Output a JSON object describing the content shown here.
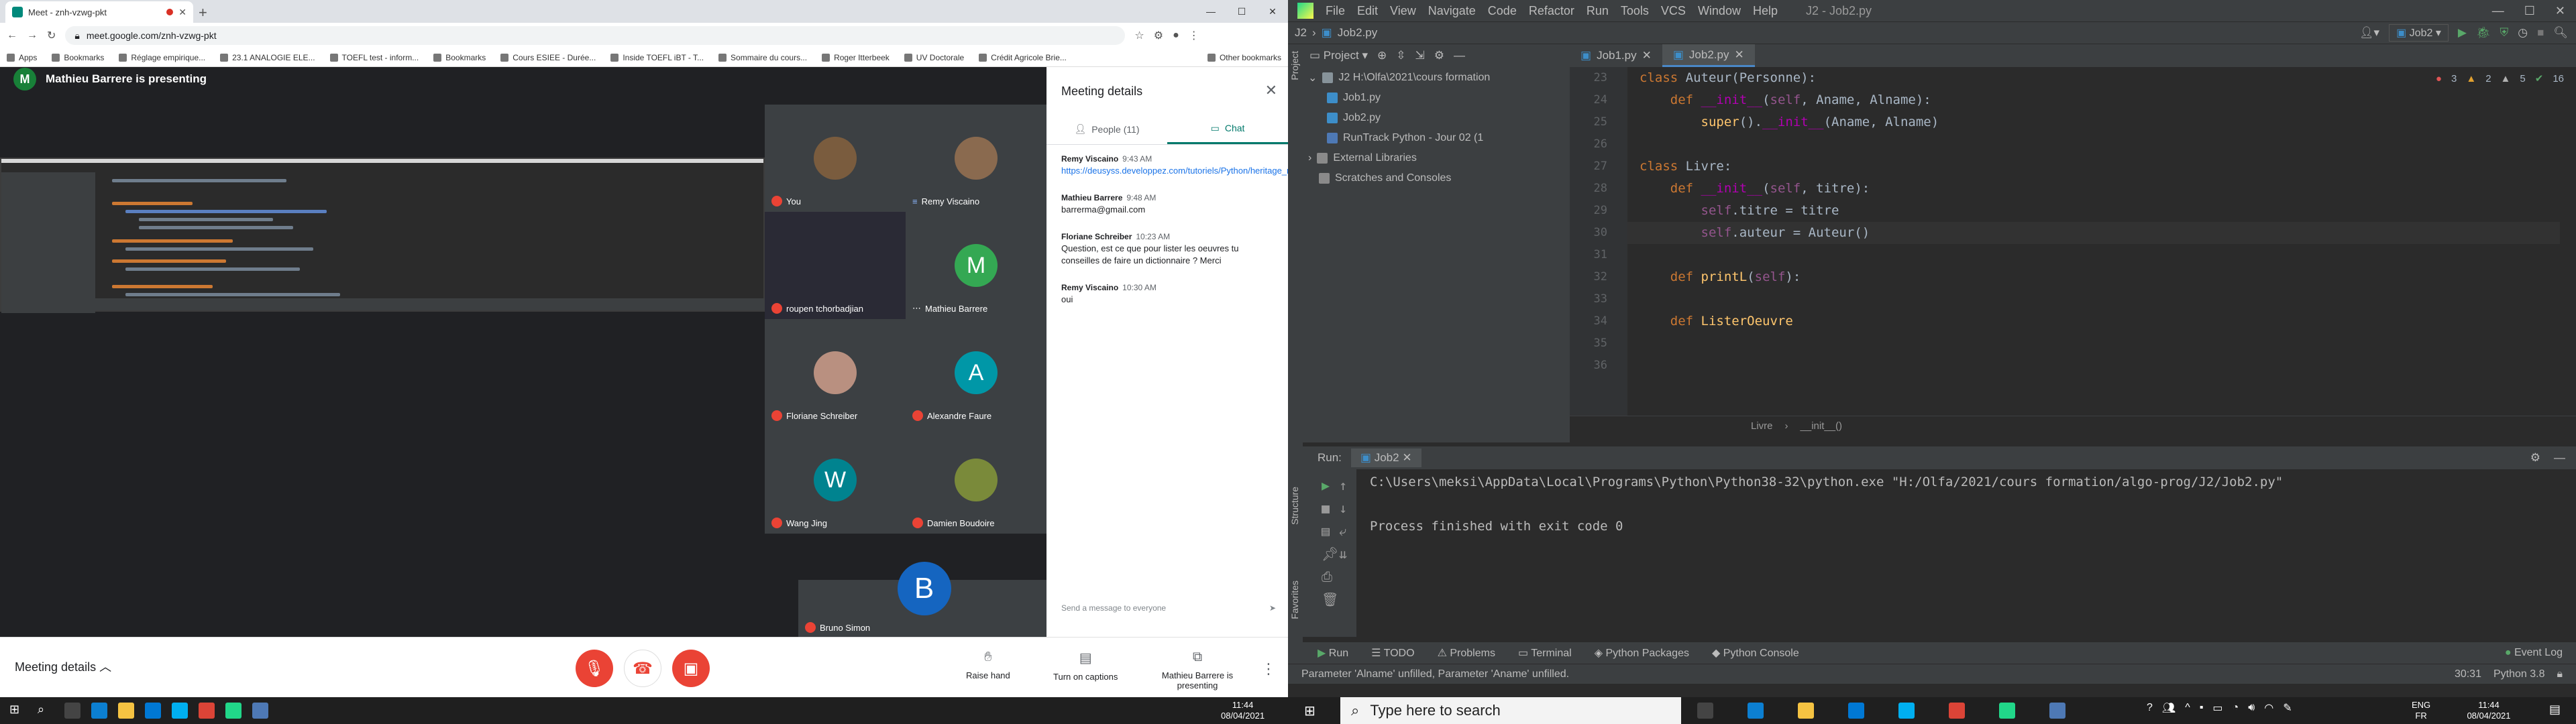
{
  "chrome": {
    "tab_title": "Meet - znh-vzwg-pkt",
    "new_tab": "+",
    "url": "meet.google.com/znh-vzwg-pkt",
    "bookmarks": [
      "Apps",
      "Bookmarks",
      "Réglage empirique...",
      "23.1 ANALOGIE ELE...",
      "TOEFL test - inform...",
      "Bookmarks",
      "Cours ESIEE - Durée...",
      "Inside TOEFL iBT - T...",
      "Sommaire du cours...",
      "Roger Itterbeek",
      "UV Doctorale",
      "Crédit Agricole Brie..."
    ],
    "other_bookmarks": "Other bookmarks"
  },
  "meet": {
    "presenter_initial": "M",
    "presenter_text": "Mathieu Barrere is presenting",
    "participants": [
      {
        "name": "You",
        "initial": "",
        "color": "#7a5c3e",
        "muted": true
      },
      {
        "name": "Remy Viscaino",
        "initial": "",
        "color": "#8a6a4f",
        "muted": false
      },
      {
        "name": "roupen tchorbadjian",
        "initial": "",
        "color": "#2a2a35",
        "muted": true
      },
      {
        "name": "Mathieu Barrere",
        "initial": "M",
        "color": "#34a853",
        "muted": false
      },
      {
        "name": "Floriane Schreiber",
        "initial": "",
        "color": "#b99080",
        "muted": true
      },
      {
        "name": "Alexandre Faure",
        "initial": "A",
        "color": "#0097a7",
        "muted": true
      },
      {
        "name": "Wang Jing",
        "initial": "W",
        "color": "#00838f",
        "muted": true
      },
      {
        "name": "Damien Boudoire",
        "initial": "",
        "color": "#7a8a3a",
        "muted": true
      }
    ],
    "big_tile": {
      "name": "Bruno Simon",
      "initial": "B",
      "color": "#1565c0"
    },
    "panel": {
      "title": "Meeting details",
      "tab_people": "People (11)",
      "tab_chat": "Chat",
      "messages": [
        {
          "who": "Remy Viscaino",
          "time": "9:43 AM",
          "text": "https://deusyss.developpez.com/tutoriels/Python/heritage_metaclasse/",
          "link": true
        },
        {
          "who": "Mathieu Barrere",
          "time": "9:48 AM",
          "text": "barrerma@gmail.com",
          "link": false
        },
        {
          "who": "Floriane Schreiber",
          "time": "10:23 AM",
          "text": "Question, est ce que pour lister les oeuvres tu conseilles de faire un dictionnaire ? Merci",
          "link": false
        },
        {
          "who": "Remy Viscaino",
          "time": "10:30 AM",
          "text": "oui",
          "link": false
        }
      ],
      "send_placeholder": "Send a message to everyone"
    },
    "controls": {
      "meeting_details": "Meeting details",
      "raise_hand": "Raise hand",
      "captions": "Turn on captions",
      "presenting": "Mathieu Barrere is presenting"
    }
  },
  "ide": {
    "menus": [
      "File",
      "Edit",
      "View",
      "Navigate",
      "Code",
      "Refactor",
      "Run",
      "Tools",
      "VCS",
      "Window",
      "Help"
    ],
    "title": "J2 - Job2.py",
    "nav_path": [
      "J2",
      "Job2.py"
    ],
    "run_config": "Job2",
    "project_label": "Project",
    "tree": [
      {
        "label": "J2  H:\\Olfa\\2021\\cours formation",
        "indent": 0,
        "color": "#87939a"
      },
      {
        "label": "Job1.py",
        "indent": 1,
        "color": "#3d8ec9"
      },
      {
        "label": "Job2.py",
        "indent": 1,
        "color": "#3d8ec9"
      },
      {
        "label": "RunTrack Python - Jour 02 (1",
        "indent": 1,
        "color": "#4e79b5"
      },
      {
        "label": "External Libraries",
        "indent": 0,
        "color": "#8a8a8a"
      },
      {
        "label": "Scratches and Consoles",
        "indent": 0,
        "color": "#8a8a8a"
      }
    ],
    "tabs": [
      "Job1.py",
      "Job2.py"
    ],
    "inspections": {
      "errors": "3",
      "warnings": "2",
      "weak": "5",
      "typos": "16"
    },
    "lines": [
      {
        "n": "23",
        "html": "<span class='kw'>class</span> <span class='cls'>Auteur</span>(Personne):"
      },
      {
        "n": "24",
        "html": "    <span class='kw'>def</span> <span class='dund'>__init__</span>(<span class='self'>self</span>, Aname, Alname):"
      },
      {
        "n": "25",
        "html": "        <span class='fn'>super</span>().<span class='dund'>__init__</span>(Aname, Alname)"
      },
      {
        "n": "26",
        "html": ""
      },
      {
        "n": "27",
        "html": "<span class='kw'>class</span> <span class='cls'>Livre</span>:"
      },
      {
        "n": "28",
        "html": "    <span class='kw'>def</span> <span class='dund'>__init__</span>(<span class='self'>self</span>, titre):"
      },
      {
        "n": "29",
        "html": "        <span class='self'>self</span>.titre = titre"
      },
      {
        "n": "30",
        "html": "        <span class='self'>self</span>.auteur = Auteur()"
      },
      {
        "n": "31",
        "html": ""
      },
      {
        "n": "32",
        "html": "    <span class='kw'>def</span> <span class='fn'>printL</span>(<span class='self'>self</span>):"
      },
      {
        "n": "33",
        "html": ""
      },
      {
        "n": "34",
        "html": "    <span class='kw'>def</span> <span class='fn'>ListerOeuvre</span>"
      },
      {
        "n": "35",
        "html": ""
      },
      {
        "n": "36",
        "html": ""
      }
    ],
    "breadcrumb": [
      "Livre",
      "__init__()"
    ],
    "run_label": "Run:",
    "run_tab": "Job2",
    "console": [
      "C:\\Users\\meksi\\AppData\\Local\\Programs\\Python\\Python38-32\\python.exe \"H:/Olfa/2021/cours formation/algo-prog/J2/Job2.py\"",
      "",
      "Process finished with exit code 0"
    ],
    "tool_tabs": [
      "Run",
      "TODO",
      "Problems",
      "Terminal",
      "Python Packages",
      "Python Console"
    ],
    "event_log": "Event Log",
    "status_msg": "Parameter 'Alname' unfilled, Parameter 'Aname' unfilled.",
    "status_pos": "30:31",
    "status_python": "Python 3.8"
  },
  "taskbar": {
    "search": "Type here to search",
    "lang_top": "ENG",
    "lang_bottom": "FR",
    "time": "11:44",
    "date": "08/04/2021",
    "mini_time": "11:44",
    "mini_date": "08/04/2021"
  }
}
